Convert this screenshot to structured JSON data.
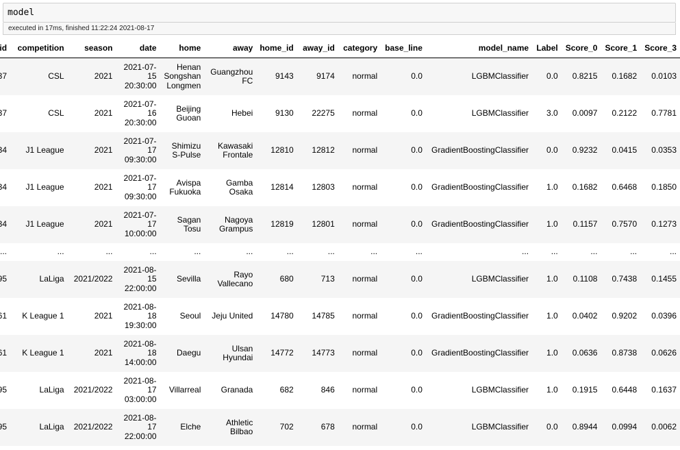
{
  "cell": {
    "code": "model",
    "exec_info": "executed in 17ms, finished 11:22:24 2021-08-17"
  },
  "table": {
    "columns": [
      "id",
      "competition",
      "season",
      "date",
      "home",
      "away",
      "home_id",
      "away_id",
      "category",
      "base_line",
      "model_name",
      "Label",
      "Score_0",
      "Score_1",
      "Score_3"
    ],
    "rows": [
      {
        "id": "37",
        "competition": "CSL",
        "season": "2021",
        "date": "2021-07-15 20:30:00",
        "home": "Henan Songshan Longmen",
        "away": "Guangzhou FC",
        "home_id": "9143",
        "away_id": "9174",
        "category": "normal",
        "base_line": "0.0",
        "model_name": "LGBMClassifier",
        "Label": "0.0",
        "Score_0": "0.8215",
        "Score_1": "0.1682",
        "Score_3": "0.0103"
      },
      {
        "id": "37",
        "competition": "CSL",
        "season": "2021",
        "date": "2021-07-16 20:30:00",
        "home": "Beijing Guoan",
        "away": "Hebei",
        "home_id": "9130",
        "away_id": "22275",
        "category": "normal",
        "base_line": "0.0",
        "model_name": "LGBMClassifier",
        "Label": "3.0",
        "Score_0": "0.0097",
        "Score_1": "0.2122",
        "Score_3": "0.7781"
      },
      {
        "id": "34",
        "competition": "J1 League",
        "season": "2021",
        "date": "2021-07-17 09:30:00",
        "home": "Shimizu S-Pulse",
        "away": "Kawasaki Frontale",
        "home_id": "12810",
        "away_id": "12812",
        "category": "normal",
        "base_line": "0.0",
        "model_name": "GradientBoostingClassifier",
        "Label": "0.0",
        "Score_0": "0.9232",
        "Score_1": "0.0415",
        "Score_3": "0.0353"
      },
      {
        "id": "34",
        "competition": "J1 League",
        "season": "2021",
        "date": "2021-07-17 09:30:00",
        "home": "Avispa Fukuoka",
        "away": "Gamba Osaka",
        "home_id": "12814",
        "away_id": "12803",
        "category": "normal",
        "base_line": "0.0",
        "model_name": "GradientBoostingClassifier",
        "Label": "1.0",
        "Score_0": "0.1682",
        "Score_1": "0.6468",
        "Score_3": "0.1850"
      },
      {
        "id": "34",
        "competition": "J1 League",
        "season": "2021",
        "date": "2021-07-17 10:00:00",
        "home": "Sagan Tosu",
        "away": "Nagoya Grampus",
        "home_id": "12819",
        "away_id": "12801",
        "category": "normal",
        "base_line": "0.0",
        "model_name": "GradientBoostingClassifier",
        "Label": "1.0",
        "Score_0": "0.1157",
        "Score_1": "0.7570",
        "Score_3": "0.1273"
      },
      {
        "ellipsis": true
      },
      {
        "id": "95",
        "competition": "LaLiga",
        "season": "2021/2022",
        "date": "2021-08-15 22:00:00",
        "home": "Sevilla",
        "away": "Rayo Vallecano",
        "home_id": "680",
        "away_id": "713",
        "category": "normal",
        "base_line": "0.0",
        "model_name": "LGBMClassifier",
        "Label": "1.0",
        "Score_0": "0.1108",
        "Score_1": "0.7438",
        "Score_3": "0.1455"
      },
      {
        "id": "61",
        "competition": "K League 1",
        "season": "2021",
        "date": "2021-08-18 19:30:00",
        "home": "Seoul",
        "away": "Jeju United",
        "home_id": "14780",
        "away_id": "14785",
        "category": "normal",
        "base_line": "0.0",
        "model_name": "GradientBoostingClassifier",
        "Label": "1.0",
        "Score_0": "0.0402",
        "Score_1": "0.9202",
        "Score_3": "0.0396"
      },
      {
        "id": "61",
        "competition": "K League 1",
        "season": "2021",
        "date": "2021-08-18 14:00:00",
        "home": "Daegu",
        "away": "Ulsan Hyundai",
        "home_id": "14772",
        "away_id": "14773",
        "category": "normal",
        "base_line": "0.0",
        "model_name": "GradientBoostingClassifier",
        "Label": "1.0",
        "Score_0": "0.0636",
        "Score_1": "0.8738",
        "Score_3": "0.0626"
      },
      {
        "id": "95",
        "competition": "LaLiga",
        "season": "2021/2022",
        "date": "2021-08-17 03:00:00",
        "home": "Villarreal",
        "away": "Granada",
        "home_id": "682",
        "away_id": "846",
        "category": "normal",
        "base_line": "0.0",
        "model_name": "LGBMClassifier",
        "Label": "1.0",
        "Score_0": "0.1915",
        "Score_1": "0.6448",
        "Score_3": "0.1637"
      },
      {
        "id": "95",
        "competition": "LaLiga",
        "season": "2021/2022",
        "date": "2021-08-17 22:00:00",
        "home": "Elche",
        "away": "Athletic Bilbao",
        "home_id": "702",
        "away_id": "678",
        "category": "normal",
        "base_line": "0.0",
        "model_name": "LGBMClassifier",
        "Label": "0.0",
        "Score_0": "0.8944",
        "Score_1": "0.0994",
        "Score_3": "0.0062"
      }
    ]
  }
}
